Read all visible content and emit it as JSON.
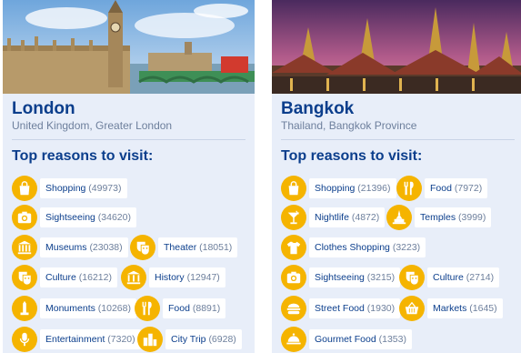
{
  "colors": {
    "brand": "#0b3e8c",
    "muted": "#6d7f9c",
    "icon_bg": "#f5b400",
    "card_bg": "#e8eef9"
  },
  "cards": [
    {
      "city": "London",
      "region": "United Kingdom, Greater London",
      "heading": "Top reasons to visit:",
      "reasons": [
        {
          "name": "Shopping",
          "count": "(49973)",
          "icon": "shopping-bag-icon"
        },
        {
          "name": "Sightseeing",
          "count": "(34620)",
          "icon": "camera-icon"
        },
        {
          "name": "Museums",
          "count": "(23038)",
          "icon": "museum-icon"
        },
        {
          "name": "Theater",
          "count": "(18051)",
          "icon": "theater-masks-icon"
        },
        {
          "name": "Culture",
          "count": "(16212)",
          "icon": "culture-masks-icon"
        },
        {
          "name": "History",
          "count": "(12947)",
          "icon": "history-building-icon"
        },
        {
          "name": "Monuments",
          "count": "(10268)",
          "icon": "monument-icon"
        },
        {
          "name": "Food",
          "count": "(8891)",
          "icon": "fork-knife-icon"
        },
        {
          "name": "Entertainment",
          "count": "(7320)",
          "icon": "microphone-icon"
        },
        {
          "name": "City Trip",
          "count": "(6928)",
          "icon": "city-buildings-icon"
        }
      ]
    },
    {
      "city": "Bangkok",
      "region": "Thailand, Bangkok Province",
      "heading": "Top reasons to visit:",
      "reasons": [
        {
          "name": "Shopping",
          "count": "(21396)",
          "icon": "shopping-bag-icon"
        },
        {
          "name": "Food",
          "count": "(7972)",
          "icon": "fork-knife-icon"
        },
        {
          "name": "Nightlife",
          "count": "(4872)",
          "icon": "cocktail-icon"
        },
        {
          "name": "Temples",
          "count": "(3999)",
          "icon": "temple-icon"
        },
        {
          "name": "Clothes Shopping",
          "count": "(3223)",
          "icon": "tshirt-icon"
        },
        {
          "name": "Sightseeing",
          "count": "(3215)",
          "icon": "camera-icon"
        },
        {
          "name": "Culture",
          "count": "(2714)",
          "icon": "culture-masks-icon"
        },
        {
          "name": "Street Food",
          "count": "(1930)",
          "icon": "burger-icon"
        },
        {
          "name": "Markets",
          "count": "(1645)",
          "icon": "basket-icon"
        },
        {
          "name": "Gourmet Food",
          "count": "(1353)",
          "icon": "cloche-icon"
        }
      ]
    }
  ]
}
